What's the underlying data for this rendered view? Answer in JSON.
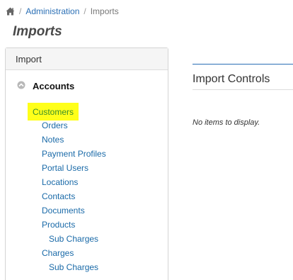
{
  "breadcrumb": {
    "home_icon": "home-icon",
    "separator": "/",
    "items": [
      {
        "label": "Administration"
      },
      {
        "label": "Imports"
      }
    ]
  },
  "page": {
    "title": "Imports"
  },
  "import_panel": {
    "header": "Import",
    "group": {
      "icon": "collapse-circle-icon",
      "label": "Accounts",
      "items": [
        {
          "label": "Customers",
          "highlighted": true
        },
        {
          "label": "Orders"
        },
        {
          "label": "Notes"
        },
        {
          "label": "Payment Profiles"
        },
        {
          "label": "Portal Users"
        },
        {
          "label": "Locations"
        },
        {
          "label": "Contacts"
        },
        {
          "label": "Documents"
        },
        {
          "label": "Products"
        },
        {
          "label": "Sub Charges",
          "indent": 2
        },
        {
          "label": "Charges"
        },
        {
          "label": "Sub Charges",
          "indent": 2
        }
      ]
    }
  },
  "import_controls": {
    "title": "Import Controls",
    "empty_message": "No items to display."
  },
  "colors": {
    "link": "#1a6aa8",
    "highlight": "#ffff1a",
    "highlight_text": "#3a8f2a"
  }
}
